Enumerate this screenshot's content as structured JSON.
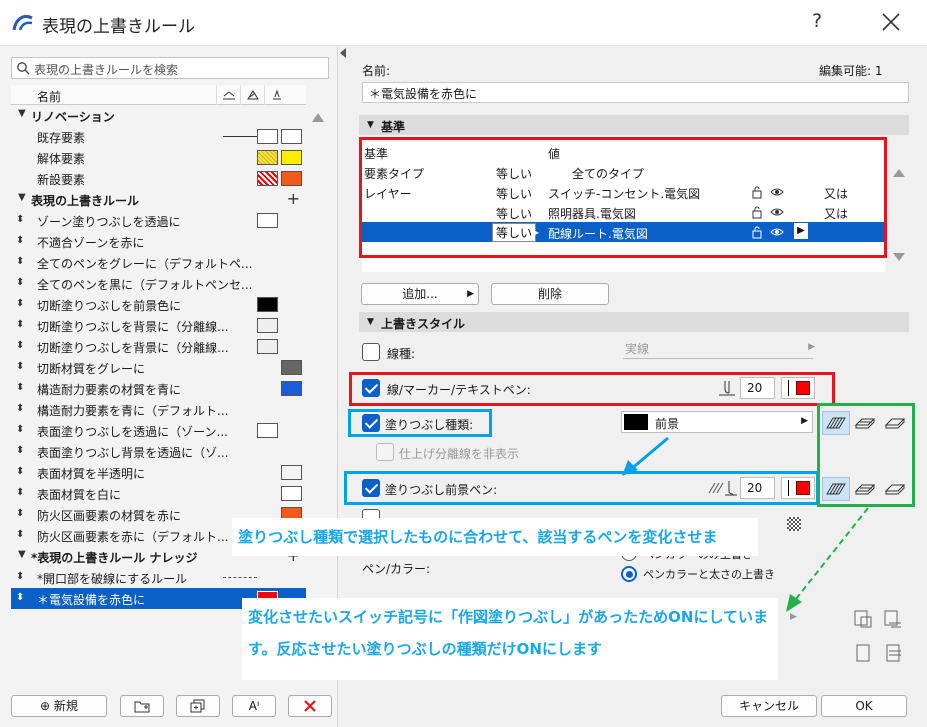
{
  "window": {
    "title": "表現の上書きルール",
    "help": "?"
  },
  "left": {
    "search_placeholder": "表現の上書きルールを検索",
    "col_name": "名前",
    "groups": [
      {
        "label": "リノベーション",
        "items": [
          {
            "label": "既存要素"
          },
          {
            "label": "解体要素"
          },
          {
            "label": "新設要素"
          }
        ]
      },
      {
        "label": "表現の上書きルール",
        "items": [
          {
            "label": "ゾーン塗りつぶしを透過に"
          },
          {
            "label": "不適合ゾーンを赤に"
          },
          {
            "label": "全てのペンをグレーに（デフォルトペ..."
          },
          {
            "label": "全てのペンを黒に（デフォルトペンセ..."
          },
          {
            "label": "切断塗りつぶしを前景色に"
          },
          {
            "label": "切断塗りつぶしを背景に（分離線..."
          },
          {
            "label": "切断塗りつぶしを背景に（分離線..."
          },
          {
            "label": "切断材質をグレーに"
          },
          {
            "label": "構造耐力要素の材質を青に"
          },
          {
            "label": "構造耐力要素を青に（デフォルト..."
          },
          {
            "label": "表面塗りつぶしを透過に（ゾーン..."
          },
          {
            "label": "表面塗りつぶし背景を透過に（ゾ..."
          },
          {
            "label": "表面材質を半透明に"
          },
          {
            "label": "表面材質を白に"
          },
          {
            "label": "防火区画要素の材質を赤に"
          },
          {
            "label": "防火区画要素を赤に（デフォルト..."
          }
        ]
      },
      {
        "label": "*表現の上書きルール ナレッジ",
        "items": [
          {
            "label": "*開口部を破線にするルール"
          },
          {
            "label": "＊電気設備を赤色に"
          }
        ]
      }
    ],
    "buttons": {
      "new": "新規"
    }
  },
  "right": {
    "name_label": "名前:",
    "editable_label": "編集可能: 1",
    "name_value": "＊電気設備を赤色に",
    "criteria_section": "基準",
    "criteria": {
      "head_criterion": "基準",
      "head_value": "値",
      "rows": [
        {
          "criterion": "要素タイプ",
          "op": "等しい",
          "value": "全てのタイプ",
          "logic": ""
        },
        {
          "criterion": "レイヤー",
          "op": "等しい",
          "value": "スイッチ-コンセント.電気図",
          "logic": "又は"
        },
        {
          "criterion": "",
          "op": "等しい",
          "value": "照明器具.電気図",
          "logic": "又は"
        },
        {
          "criterion": "",
          "op": "等しい",
          "value": "配線ルート.電気図",
          "logic": ""
        }
      ]
    },
    "add_button": "追加...",
    "delete_button": "削除",
    "style_section": "上書きスタイル",
    "line_type_label": "線種:",
    "line_type_value": "実線",
    "pen_label": "線/マーカー/テキストペン:",
    "pen_value": "20",
    "fill_type_label": "塗りつぶし種類:",
    "fill_type_value": "前景",
    "hide_sep_label": "仕上げ分離線を非表示",
    "fill_fg_label": "塗りつぶし前景ペン:",
    "fill_fg_value": "20",
    "pen_color_label": "ペン/カラー:",
    "radio1": "ペンカラーのみ上書き",
    "radio2": "ペンカラーと太さの上書き",
    "cancel": "キャンセル",
    "ok": "OK"
  },
  "notes": {
    "note1": "塗りつぶし種類で選択したものに合わせて、該当するペンを変化させま",
    "note2_line1": "変化させたいスイッチ記号に「作図塗りつぶし」があったためONにしていま",
    "note2_line2": "す。反応させたい塗りつぶしの種類だけONにします"
  },
  "colors": {
    "accent": "#0a60c7",
    "red_marker": "#e3161f",
    "blue_marker": "#00a2e8",
    "green_marker": "#22b14c"
  }
}
